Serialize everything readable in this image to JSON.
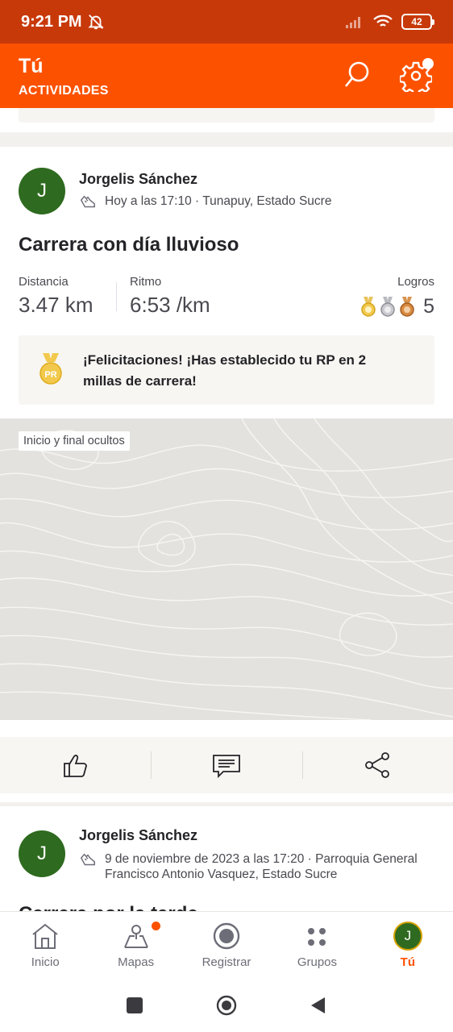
{
  "status_bar": {
    "time": "9:21 PM",
    "battery": "42"
  },
  "header": {
    "title": "Tú",
    "subtitle": "ACTIVIDADES",
    "accent_color": "#fc5200"
  },
  "activity": {
    "author": "Jorgelis Sánchez",
    "avatar_initial": "J",
    "meta": "Hoy a las 17:10 · Tunapuy, Estado Sucre",
    "title": "Carrera con día lluvioso",
    "stats": {
      "distance_label": "Distancia",
      "distance_value": "3.47 km",
      "pace_label": "Ritmo",
      "pace_value": "6:53 /km",
      "achievements_label": "Logros",
      "achievements_count": "5"
    },
    "pr_message": "¡Felicitaciones! ¡Has establecido tu RP en 2 millas de carrera!",
    "pr_badge": "PR",
    "map_chip": "Inicio y final ocultos"
  },
  "activity2": {
    "author": "Jorgelis Sánchez",
    "avatar_initial": "J",
    "meta": "9 de noviembre de 2023 a las 17:20 · Parroquia General Francisco Antonio Vasquez, Estado Sucre",
    "title": "Carrera por la tarde"
  },
  "tabs": [
    {
      "label": "Inicio",
      "icon": "home-icon"
    },
    {
      "label": "Mapas",
      "icon": "maps-icon"
    },
    {
      "label": "Registrar",
      "icon": "record-icon"
    },
    {
      "label": "Grupos",
      "icon": "groups-icon"
    },
    {
      "label": "Tú",
      "icon": "avatar",
      "avatar_initial": "J"
    }
  ]
}
